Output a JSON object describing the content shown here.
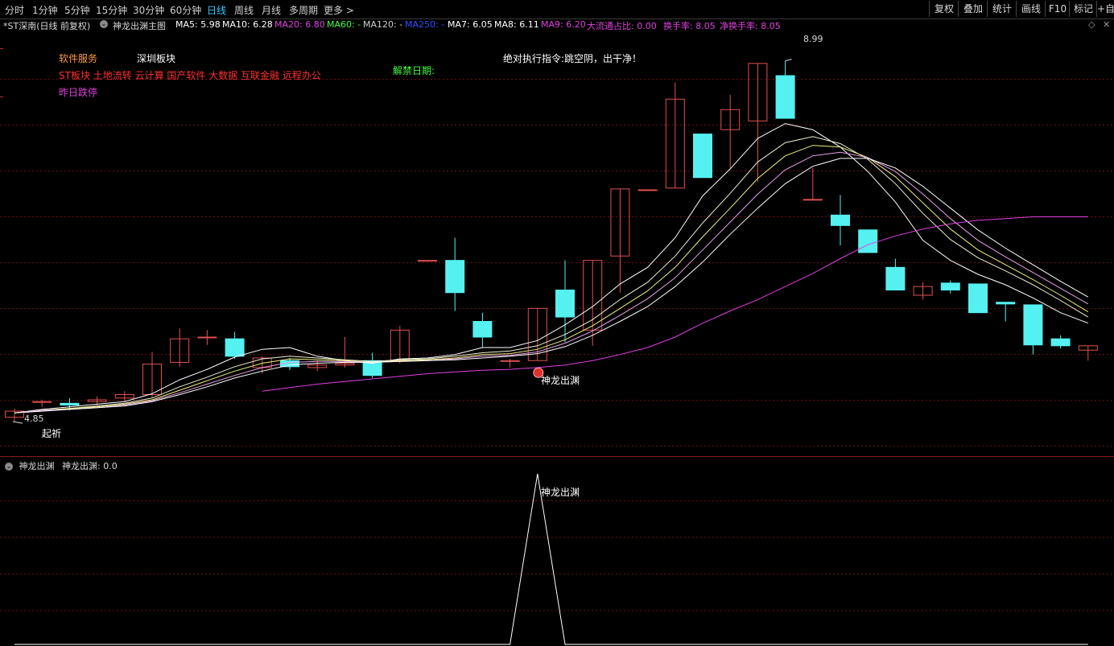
{
  "toolbar": {
    "periods": [
      "分时",
      "1分钟",
      "5分钟",
      "15分钟",
      "30分钟",
      "60分钟",
      "日线",
      "周线",
      "月线",
      "多周期",
      "更多 >"
    ],
    "active_period": "日线",
    "right_buttons": [
      "复权",
      "叠加",
      "统计",
      "画线",
      "F10",
      "标记",
      "+自"
    ]
  },
  "info_bar": {
    "stock": "*ST深南(日线 前复权)",
    "chart_name": "神龙出渊主图",
    "items": [
      {
        "text": "MA5: 5.98",
        "color": "#ffffff"
      },
      {
        "text": "MA10: 6.28",
        "color": "#ffffff"
      },
      {
        "text": "MA20: 6.80",
        "color": "#e040e0"
      },
      {
        "text": "MA60: -",
        "color": "#40ff40"
      },
      {
        "text": "MA120: -",
        "color": "#d0d0d0"
      },
      {
        "text": "MA250: -",
        "color": "#3050ff"
      },
      {
        "text": "MA7: 6.05",
        "color": "#ffffff"
      },
      {
        "text": "MA8: 6.11",
        "color": "#ffffff"
      },
      {
        "text": "MA9: 6.20",
        "color": "#e040e0"
      },
      {
        "text": "大流通占比: 0.00",
        "color": "#e040e0"
      },
      {
        "text": "换手率: 8.05",
        "color": "#e040e0"
      },
      {
        "text": "净换手率: 8.05",
        "color": "#e040e0"
      }
    ]
  },
  "annotations": {
    "software": "软件服务",
    "sector": "深圳板块",
    "concepts": "ST板块 土地流转 云计算 国产软件 大数据 互联金融 远程办公",
    "yesterday": "昨日跌停",
    "unlock": "解禁日期:",
    "instruction": "绝对执行指令:跳空阴，出干净！",
    "high_label": "8.99",
    "low_label": "4.85",
    "start_label": "起祈",
    "signal_label": "神龙出渊"
  },
  "sub_panel": {
    "title": "神龙出渊",
    "value_label": "神龙出渊: 0.0",
    "peak_label": "神龙出渊"
  },
  "colors": {
    "up": "#e05050",
    "down": "#55f0f0",
    "ma_white": "#ffffff",
    "ma_pink": "#e040e0",
    "ma_yellow": "#f0f080",
    "grid": "#6a1010"
  },
  "chart_data": {
    "type": "candlestick",
    "y_range": [
      4.5,
      9.3
    ],
    "high_marker": 8.99,
    "low_marker": 4.85,
    "candles": [
      {
        "o": 4.9,
        "c": 4.97,
        "h": 5.0,
        "l": 4.85
      },
      {
        "o": 5.08,
        "c": 5.08,
        "h": 5.1,
        "l": 5.02
      },
      {
        "o": 5.06,
        "c": 5.04,
        "h": 5.12,
        "l": 4.98
      },
      {
        "o": 5.08,
        "c": 5.1,
        "h": 5.14,
        "l": 5.04
      },
      {
        "o": 5.12,
        "c": 5.16,
        "h": 5.2,
        "l": 5.08
      },
      {
        "o": 5.16,
        "c": 5.51,
        "h": 5.65,
        "l": 5.13
      },
      {
        "o": 5.53,
        "c": 5.8,
        "h": 5.92,
        "l": 5.48
      },
      {
        "o": 5.82,
        "c": 5.82,
        "h": 5.9,
        "l": 5.73
      },
      {
        "o": 5.8,
        "c": 5.6,
        "h": 5.88,
        "l": 5.57
      },
      {
        "o": 5.47,
        "c": 5.58,
        "h": 5.6,
        "l": 5.4
      },
      {
        "o": 5.55,
        "c": 5.48,
        "h": 5.58,
        "l": 5.44
      },
      {
        "o": 5.47,
        "c": 5.5,
        "h": 5.55,
        "l": 5.43
      },
      {
        "o": 5.5,
        "c": 5.52,
        "h": 5.82,
        "l": 5.47
      },
      {
        "o": 5.55,
        "c": 5.38,
        "h": 5.64,
        "l": 5.35
      },
      {
        "o": 5.55,
        "c": 5.9,
        "h": 5.95,
        "l": 5.52
      },
      {
        "o": 6.7,
        "c": 6.7,
        "h": 6.7,
        "l": 6.7
      },
      {
        "o": 6.7,
        "c": 6.33,
        "h": 6.96,
        "l": 6.12
      },
      {
        "o": 6.0,
        "c": 5.82,
        "h": 6.1,
        "l": 5.7
      },
      {
        "o": 5.54,
        "c": 5.55,
        "h": 5.57,
        "l": 5.47
      },
      {
        "o": 5.55,
        "c": 6.15,
        "h": 6.15,
        "l": 5.55
      },
      {
        "o": 6.36,
        "c": 6.05,
        "h": 6.7,
        "l": 5.76
      },
      {
        "o": 5.9,
        "c": 6.7,
        "h": 6.7,
        "l": 5.72
      },
      {
        "o": 6.75,
        "c": 7.52,
        "h": 7.52,
        "l": 6.33
      },
      {
        "o": 7.51,
        "c": 7.51,
        "h": 7.51,
        "l": 7.51
      },
      {
        "o": 7.53,
        "c": 8.55,
        "h": 8.74,
        "l": 7.53
      },
      {
        "o": 8.15,
        "c": 7.65,
        "h": 8.15,
        "l": 7.65
      },
      {
        "o": 8.2,
        "c": 8.43,
        "h": 8.6,
        "l": 7.76
      },
      {
        "o": 8.3,
        "c": 8.96,
        "h": 8.96,
        "l": 7.6
      },
      {
        "o": 8.82,
        "c": 8.33,
        "h": 8.99,
        "l": 8.33
      },
      {
        "o": 7.4,
        "c": 7.4,
        "h": 7.76,
        "l": 7.39
      },
      {
        "o": 7.22,
        "c": 7.1,
        "h": 7.45,
        "l": 6.87
      },
      {
        "o": 7.05,
        "c": 6.79,
        "h": 7.05,
        "l": 6.79
      },
      {
        "o": 6.62,
        "c": 6.36,
        "h": 6.72,
        "l": 6.36
      },
      {
        "o": 6.3,
        "c": 6.4,
        "h": 6.45,
        "l": 6.25
      },
      {
        "o": 6.44,
        "c": 6.36,
        "h": 6.47,
        "l": 6.32
      },
      {
        "o": 6.43,
        "c": 6.1,
        "h": 6.43,
        "l": 6.1
      },
      {
        "o": 6.22,
        "c": 6.2,
        "h": 6.22,
        "l": 6.0
      },
      {
        "o": 6.19,
        "c": 5.73,
        "h": 6.19,
        "l": 5.62
      },
      {
        "o": 5.8,
        "c": 5.72,
        "h": 5.84,
        "l": 5.69
      },
      {
        "o": 5.67,
        "c": 5.72,
        "h": 5.72,
        "l": 5.55
      }
    ],
    "ma_lines": [
      {
        "name": "MA5",
        "color": "#ffffff",
        "start": 0,
        "values": [
          4.95,
          4.99,
          5.02,
          5.05,
          5.08,
          5.17,
          5.33,
          5.45,
          5.59,
          5.68,
          5.7,
          5.6,
          5.55,
          5.52,
          5.57,
          5.58,
          5.62,
          5.7,
          5.7,
          5.78,
          5.96,
          6.17,
          6.43,
          6.62,
          6.96,
          7.44,
          7.75,
          8.1,
          8.27,
          8.2,
          8.0,
          7.72,
          7.37,
          6.93,
          6.7,
          6.54,
          6.42,
          6.27,
          6.1,
          5.98
        ]
      },
      {
        "name": "MA7",
        "color": "#f0f0d0",
        "start": 0,
        "values": [
          4.95,
          4.98,
          5.0,
          5.03,
          5.06,
          5.12,
          5.25,
          5.36,
          5.48,
          5.57,
          5.6,
          5.58,
          5.56,
          5.54,
          5.56,
          5.57,
          5.6,
          5.64,
          5.66,
          5.72,
          5.85,
          6.02,
          6.25,
          6.45,
          6.75,
          7.13,
          7.47,
          7.83,
          8.05,
          8.12,
          8.04,
          7.86,
          7.58,
          7.24,
          6.94,
          6.73,
          6.58,
          6.42,
          6.24,
          6.05
        ]
      },
      {
        "name": "MA8",
        "color": "#f0f080",
        "start": 0,
        "values": [
          4.95,
          4.98,
          5.0,
          5.02,
          5.05,
          5.1,
          5.21,
          5.32,
          5.43,
          5.52,
          5.57,
          5.56,
          5.55,
          5.53,
          5.55,
          5.56,
          5.58,
          5.62,
          5.63,
          5.68,
          5.79,
          5.95,
          6.15,
          6.35,
          6.62,
          6.97,
          7.3,
          7.64,
          7.9,
          8.02,
          8.0,
          7.88,
          7.66,
          7.36,
          7.06,
          6.82,
          6.65,
          6.48,
          6.3,
          6.11
        ]
      },
      {
        "name": "MA9",
        "color": "#e8a0e8",
        "start": 0,
        "values": [
          4.95,
          4.98,
          4.99,
          5.01,
          5.04,
          5.09,
          5.18,
          5.28,
          5.38,
          5.47,
          5.53,
          5.54,
          5.54,
          5.53,
          5.54,
          5.55,
          5.57,
          5.6,
          5.61,
          5.65,
          5.75,
          5.89,
          6.07,
          6.26,
          6.5,
          6.82,
          7.14,
          7.46,
          7.74,
          7.9,
          7.94,
          7.88,
          7.72,
          7.46,
          7.18,
          6.93,
          6.74,
          6.56,
          6.38,
          6.2
        ]
      },
      {
        "name": "MA10",
        "color": "#ffffff",
        "start": 0,
        "values": [
          4.95,
          4.97,
          4.99,
          5.01,
          5.03,
          5.08,
          5.16,
          5.25,
          5.35,
          5.43,
          5.5,
          5.52,
          5.53,
          5.53,
          5.54,
          5.55,
          5.56,
          5.58,
          5.6,
          5.63,
          5.71,
          5.84,
          6.0,
          6.17,
          6.4,
          6.68,
          7.0,
          7.3,
          7.58,
          7.78,
          7.87,
          7.87,
          7.76,
          7.55,
          7.3,
          7.05,
          6.84,
          6.65,
          6.46,
          6.28
        ]
      },
      {
        "name": "MA20",
        "color": "#e040e0",
        "start": 9,
        "values": [
          5.2,
          5.24,
          5.28,
          5.31,
          5.34,
          5.37,
          5.4,
          5.42,
          5.44,
          5.45,
          5.47,
          5.5,
          5.55,
          5.62,
          5.7,
          5.82,
          5.98,
          6.12,
          6.25,
          6.4,
          6.55,
          6.72,
          6.88,
          6.98,
          7.06,
          7.12,
          7.16,
          7.18,
          7.2,
          7.2,
          7.2
        ]
      }
    ],
    "indicator": {
      "name": "神龙出渊",
      "values": [
        0,
        0,
        0,
        0,
        0,
        0,
        0,
        0,
        0,
        0,
        0,
        0,
        0,
        0,
        0,
        0,
        0,
        0,
        0,
        1,
        0,
        0,
        0,
        0,
        0,
        0,
        0,
        0,
        0,
        0,
        0,
        0,
        0,
        0,
        0,
        0,
        0,
        0,
        0,
        0
      ],
      "signal_index": 19
    }
  }
}
